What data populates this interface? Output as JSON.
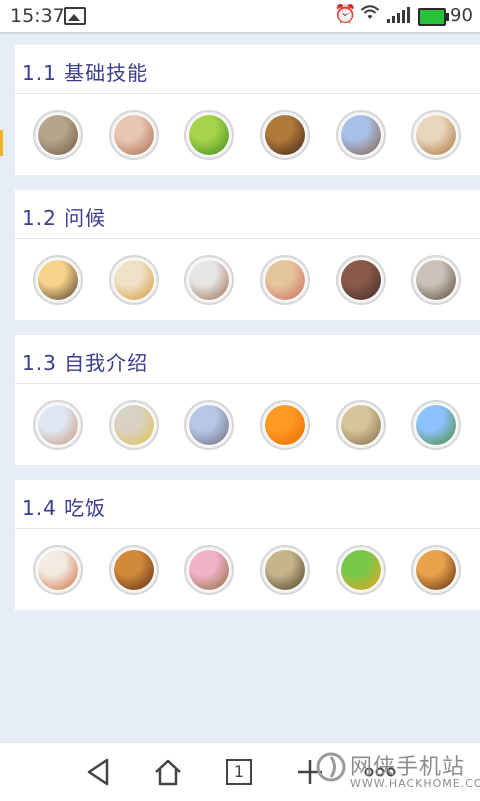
{
  "status_bar": {
    "time": "15:37",
    "battery": "90",
    "icons": [
      "image-icon",
      "alarm-icon",
      "wifi-icon",
      "signal-icon",
      "battery-icon"
    ]
  },
  "sections": [
    {
      "title": "1.1 基础技能",
      "thumbs": [
        {
          "name": "cat-thumbnail",
          "color_a": "#b6a58c",
          "color_b": "#6e5a45"
        },
        {
          "name": "people-thumbnail",
          "color_a": "#e8c6b4",
          "color_b": "#a86a4a"
        },
        {
          "name": "apple-thumbnail",
          "color_a": "#a6d34a",
          "color_b": "#3f8a1e"
        },
        {
          "name": "horse-thumbnail",
          "color_a": "#b07a3a",
          "color_b": "#3a2414"
        },
        {
          "name": "building-thumbnail",
          "color_a": "#a8c0e6",
          "color_b": "#8a5a44"
        },
        {
          "name": "bowls-thumbnail",
          "color_a": "#e9d7bd",
          "color_b": "#a5703a"
        }
      ]
    },
    {
      "title": "1.2 问候",
      "thumbs": [
        {
          "name": "sunset-thumbnail",
          "color_a": "#f7d38a",
          "color_b": "#4a3a2a"
        },
        {
          "name": "handshake-thumbnail",
          "color_a": "#f0e2c8",
          "color_b": "#d49a3a"
        },
        {
          "name": "couple-thumbnail",
          "color_a": "#e6e6e6",
          "color_b": "#9b6b4b"
        },
        {
          "name": "family-thumbnail",
          "color_a": "#e4c69a",
          "color_b": "#cf6a6a"
        },
        {
          "name": "girl-thumbnail",
          "color_a": "#8a5a48",
          "color_b": "#3b2a2a"
        },
        {
          "name": "man-thumbnail",
          "color_a": "#c9c2b8",
          "color_b": "#5a4636"
        }
      ]
    },
    {
      "title": "1.3 自我介绍",
      "thumbs": [
        {
          "name": "mother-child-thumbnail",
          "color_a": "#dfe8f2",
          "color_b": "#c89878"
        },
        {
          "name": "bedroom-thumbnail",
          "color_a": "#d8d2c4",
          "color_b": "#e0c24a"
        },
        {
          "name": "city-thumbnail",
          "color_a": "#b6c8e6",
          "color_b": "#6a6a78"
        },
        {
          "name": "orange-tiles-thumbnail",
          "color_a": "#ff9a22",
          "color_b": "#e86a00"
        },
        {
          "name": "blonde-girl-thumbnail",
          "color_a": "#d8c49a",
          "color_b": "#7d6a4a"
        },
        {
          "name": "tree-thumbnail",
          "color_a": "#8ec2ff",
          "color_b": "#4a8a2a"
        }
      ]
    },
    {
      "title": "1.4 吃饭",
      "thumbs": [
        {
          "name": "eating-thumbnail",
          "color_a": "#f2ebe2",
          "color_b": "#d06a3a"
        },
        {
          "name": "roast-chicken-thumbnail",
          "color_a": "#d08a3a",
          "color_b": "#5a2a12"
        },
        {
          "name": "donuts-thumbnail",
          "color_a": "#f2b2c8",
          "color_b": "#8a6a3a"
        },
        {
          "name": "rice-thumbnail",
          "color_a": "#c6b48a",
          "color_b": "#4a3a26"
        },
        {
          "name": "lime-juice-thumbnail",
          "color_a": "#78c84a",
          "color_b": "#f0a020"
        },
        {
          "name": "burger-thumbnail",
          "color_a": "#e8a24a",
          "color_b": "#5a2a12"
        }
      ]
    }
  ],
  "nav_bar": {
    "page_count": "1",
    "buttons": [
      "back-icon",
      "home-icon",
      "tabs-icon",
      "add-icon",
      "more-icon"
    ]
  },
  "watermark": {
    "text": "网侠手机站",
    "url_text": "WWW.HACKHOME.COM"
  }
}
